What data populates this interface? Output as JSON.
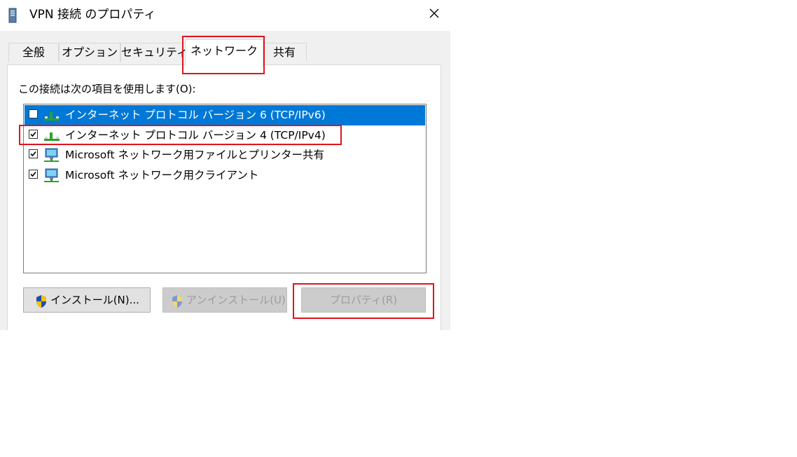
{
  "window": {
    "title": "VPN 接続 のプロパティ"
  },
  "tabs": [
    {
      "label": "全般"
    },
    {
      "label": "オプション"
    },
    {
      "label": "セキュリティ"
    },
    {
      "label": "ネットワーク",
      "active": true
    },
    {
      "label": "共有"
    }
  ],
  "panel": {
    "items_label": "この接続は次の項目を使用します(O):",
    "items": [
      {
        "label": "インターネット プロトコル バージョン 6 (TCP/IPv6)",
        "checked": false,
        "selected": true,
        "icon": "network-protocol-icon"
      },
      {
        "label": "インターネット プロトコル バージョン 4 (TCP/IPv4)",
        "checked": true,
        "selected": false,
        "icon": "network-protocol-icon"
      },
      {
        "label": "Microsoft ネットワーク用ファイルとプリンター共有",
        "checked": true,
        "selected": false,
        "icon": "network-computer-icon"
      },
      {
        "label": "Microsoft ネットワーク用クライアント",
        "checked": true,
        "selected": false,
        "icon": "network-computer-icon"
      }
    ],
    "buttons": {
      "install": "インストール(N)...",
      "uninstall": "アンインストール(U)",
      "properties": "プロパティ(R)"
    }
  },
  "colors": {
    "selection": "#0078d7",
    "highlight_box": "#e0141e",
    "dialog_bg": "#f0f0f0"
  }
}
